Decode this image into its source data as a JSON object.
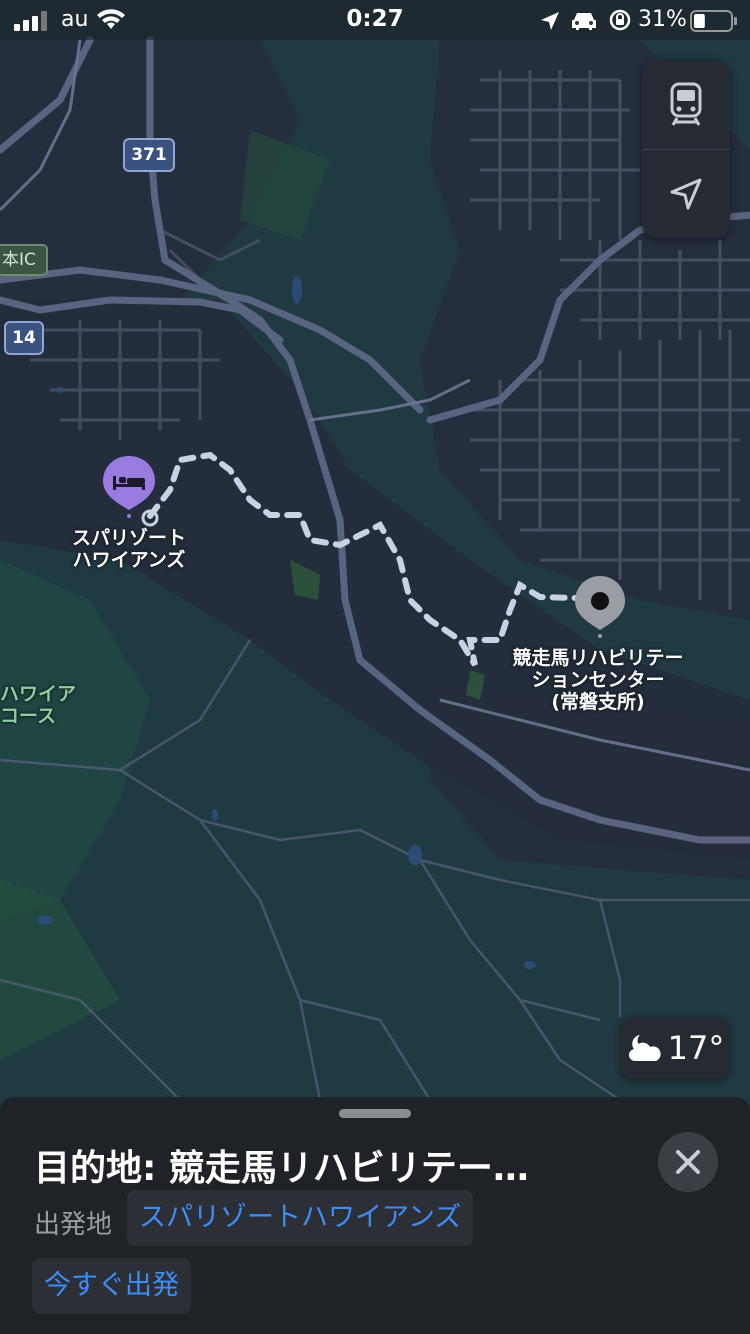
{
  "status_bar": {
    "carrier": "au",
    "time": "0:27",
    "battery_percent": "31%",
    "battery_level": 0.31
  },
  "map": {
    "road_shields": [
      "371",
      "14"
    ],
    "ic_label": "本IC",
    "poi_origin_label": "スパリゾート\nハワイアンズ",
    "poi_destination_label": "競走馬リハビリテー\nションセンター\n(常磐支所)",
    "area_label": "ハワイア\nコース",
    "origin_icon": "bed-icon",
    "destination_icon": "pin-icon"
  },
  "controls": {
    "transit_icon": "train-icon",
    "locate_icon": "location-arrow-icon"
  },
  "weather": {
    "icon": "partly-cloudy-night-icon",
    "temperature": "17°"
  },
  "sheet": {
    "title": "目的地: 競走馬リハビリテー…",
    "origin_label": "出発地",
    "origin_value": "スパリゾートハワイアンズ",
    "depart_label": "今すぐ出発",
    "close_icon": "close-icon"
  },
  "colors": {
    "map_background": "#1f3a40",
    "accent_blue": "#3e8df4",
    "origin_pin": "#9a7ce0",
    "destination_pin": "#9a9da3",
    "route_dash": "#c9d2e4"
  }
}
